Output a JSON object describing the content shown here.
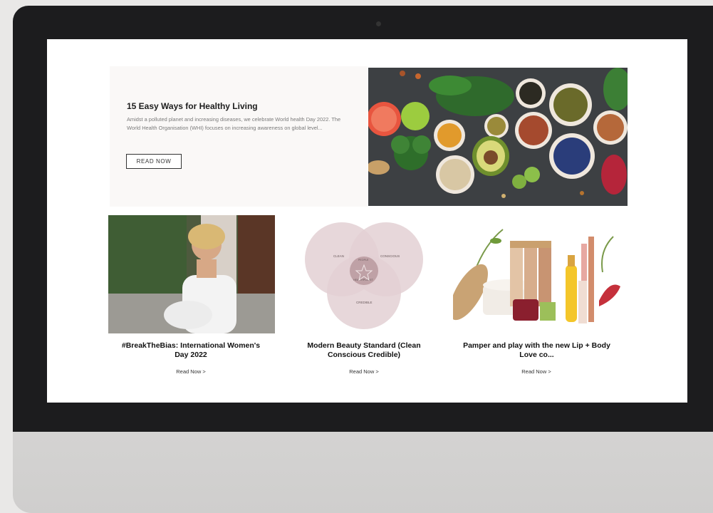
{
  "hero": {
    "title": "15 Easy Ways for Healthy Living",
    "excerpt": "Amidst a polluted planet and increasing diseases, we celebrate World health Day 2022. The World Health Organisation (WHI) focuses on increasing awareness on global level...",
    "button_label": "READ NOW"
  },
  "cards": [
    {
      "title": "#BreakTheBias: International Women's Day 2022",
      "link_label": "Read Now >"
    },
    {
      "title": "Modern Beauty Standard (Clean Conscious Credible)",
      "link_label": "Read Now >"
    },
    {
      "title": "Pamper and play with the new Lip + Body Love co...",
      "link_label": "Read Now >"
    }
  ],
  "venn": {
    "labels": [
      "CLEAN",
      "CONSCIOUS",
      "CREDIBLE",
      "PEOPLE",
      "PLANET",
      "HEALTH"
    ]
  },
  "colors": {
    "screen_bg": "#ffffff",
    "hero_panel_bg": "#faf8f7",
    "venn_fill": "#d9c3c6",
    "bezel": "#1c1c1e"
  }
}
